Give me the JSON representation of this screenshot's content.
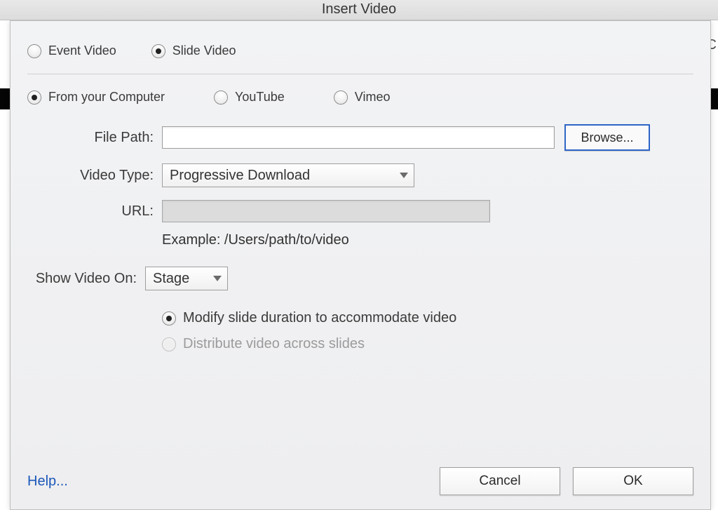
{
  "window": {
    "title": "Insert Video",
    "bg_text": "C"
  },
  "video_type_group": {
    "options": [
      "Event Video",
      "Slide Video"
    ],
    "selected": "Slide Video"
  },
  "source_group": {
    "options": [
      "From your Computer",
      "YouTube",
      "Vimeo"
    ],
    "selected": "From your Computer"
  },
  "form": {
    "file_path": {
      "label": "File Path:",
      "value": ""
    },
    "browse_label": "Browse...",
    "video_type": {
      "label": "Video Type:",
      "value": "Progressive Download"
    },
    "url": {
      "label": "URL:",
      "value": "",
      "disabled": true
    },
    "example_text": "Example: /Users/path/to/video",
    "show_on": {
      "label": "Show Video On:",
      "value": "Stage"
    }
  },
  "duration_group": {
    "options": [
      {
        "label": "Modify slide duration to accommodate video",
        "disabled": false
      },
      {
        "label": "Distribute video across slides",
        "disabled": true
      }
    ],
    "selected": "Modify slide duration to accommodate video"
  },
  "footer": {
    "help_label": "Help...",
    "cancel_label": "Cancel",
    "ok_label": "OK"
  }
}
